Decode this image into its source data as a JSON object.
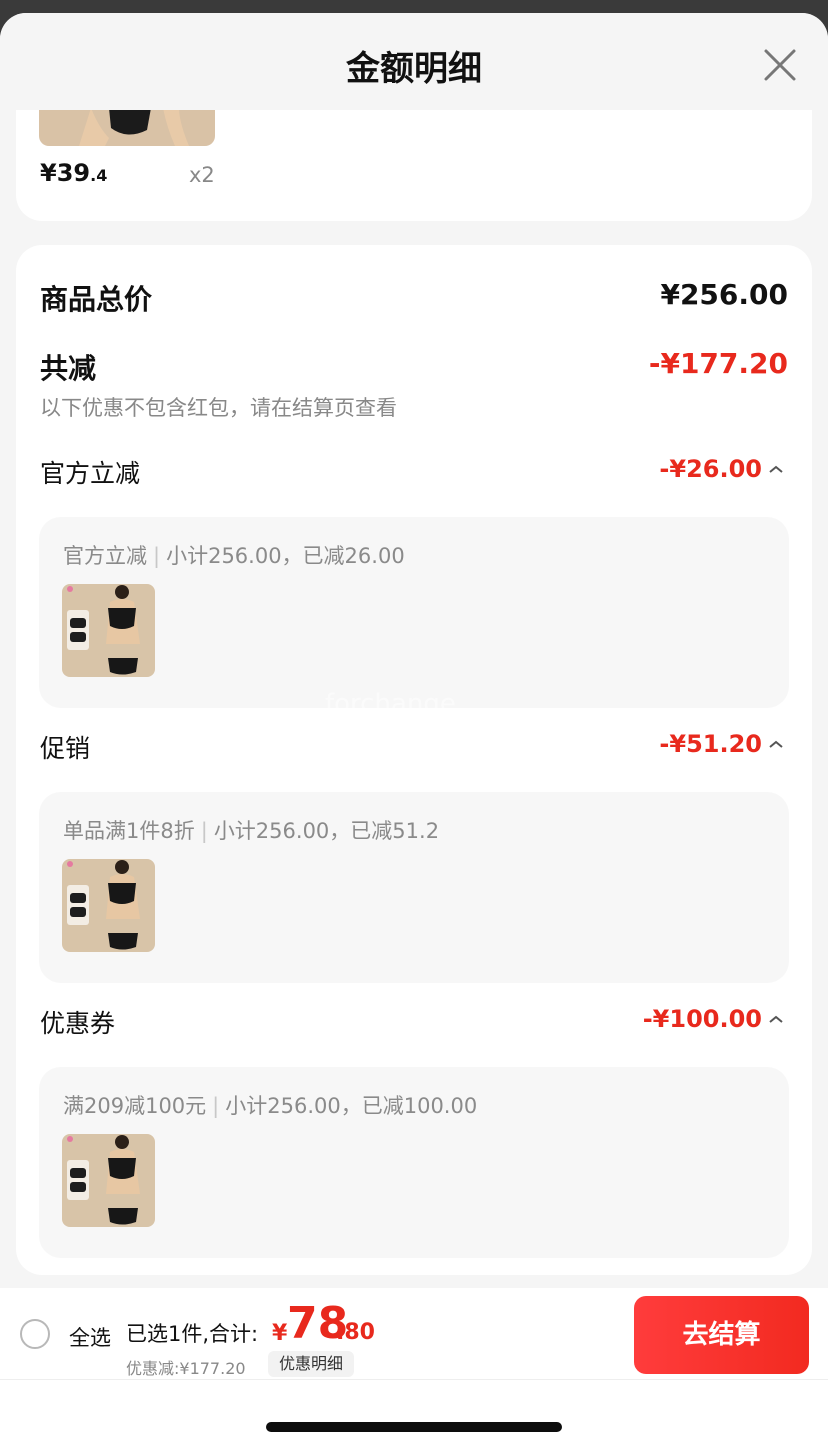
{
  "header": {
    "title": "金额明细"
  },
  "product": {
    "price_int": "¥39",
    "price_dec": ".4",
    "qty": "x2"
  },
  "summary": {
    "total_label": "商品总价",
    "total_value": "¥256.00",
    "reduce_label": "共减",
    "reduce_value": "-¥177.20",
    "note": "以下优惠不包含红包，请在结算页查看"
  },
  "sections": [
    {
      "title": "官方立减",
      "amount": "-¥26.00",
      "desc_a": "官方立减",
      "desc_b": "小计256.00，已减26.00"
    },
    {
      "title": "促销",
      "amount": "-¥51.20",
      "desc_a": "单品满1件8折",
      "desc_b": "小计256.00，已减51.2"
    },
    {
      "title": "优惠券",
      "amount": "-¥100.00",
      "desc_a": "满209减100元",
      "desc_b": "小计256.00，已减100.00"
    }
  ],
  "watermark": "forchange",
  "bottom": {
    "select_all": "全选",
    "selected": "已选1件,合计:",
    "currency": "¥",
    "total_int": "78",
    "total_dec": ".80",
    "discount": "优惠减:¥177.20",
    "detail_link": "优惠明细",
    "checkout": "去结算"
  },
  "colors": {
    "accent_red": "#e8291d",
    "background": "#f5f5f5"
  }
}
